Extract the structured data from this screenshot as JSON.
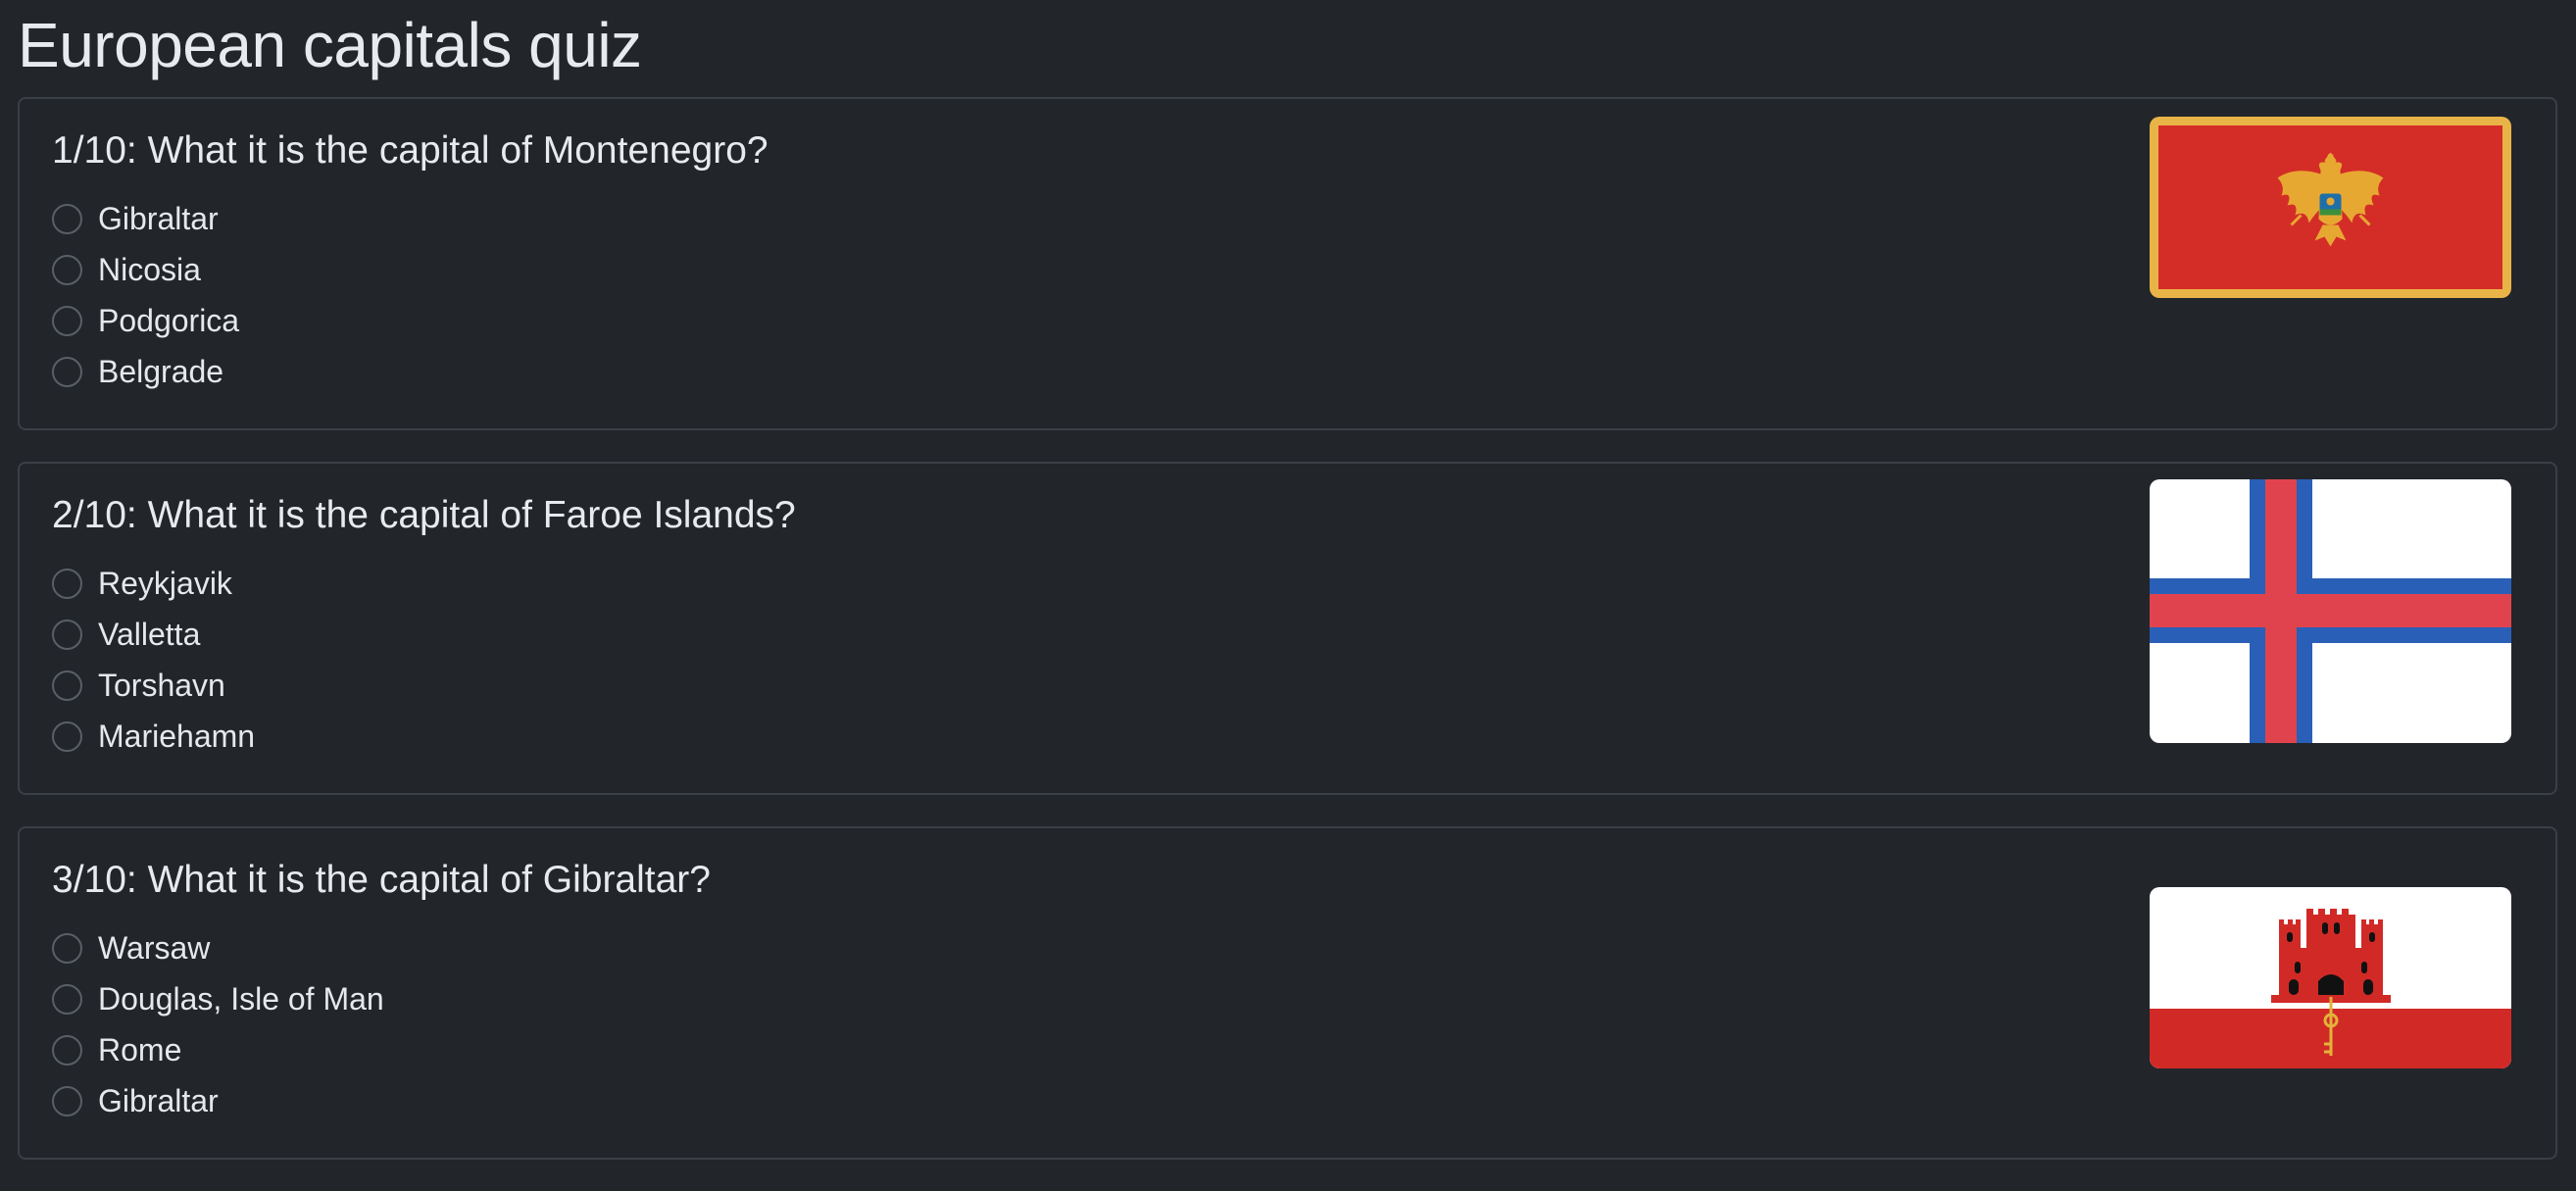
{
  "page": {
    "title": "European capitals quiz"
  },
  "questions": [
    {
      "title": "1/10: What it is the capital of Montenegro?",
      "options": [
        "Gibraltar",
        "Nicosia",
        "Podgorica",
        "Belgrade"
      ],
      "flag_icon": "montenegro-flag-icon"
    },
    {
      "title": "2/10: What it is the capital of Faroe Islands?",
      "options": [
        "Reykjavik",
        "Valletta",
        "Torshavn",
        "Mariehamn"
      ],
      "flag_icon": "faroe-islands-flag-icon"
    },
    {
      "title": "3/10: What it is the capital of Gibraltar?",
      "options": [
        "Warsaw",
        "Douglas, Isle of Man",
        "Rome",
        "Gibraltar"
      ],
      "flag_icon": "gibraltar-flag-icon"
    }
  ],
  "colors": {
    "background": "#22252a",
    "card_border": "#3b3f46",
    "text": "#e6e8eb",
    "radio_border": "#5a5f67"
  }
}
